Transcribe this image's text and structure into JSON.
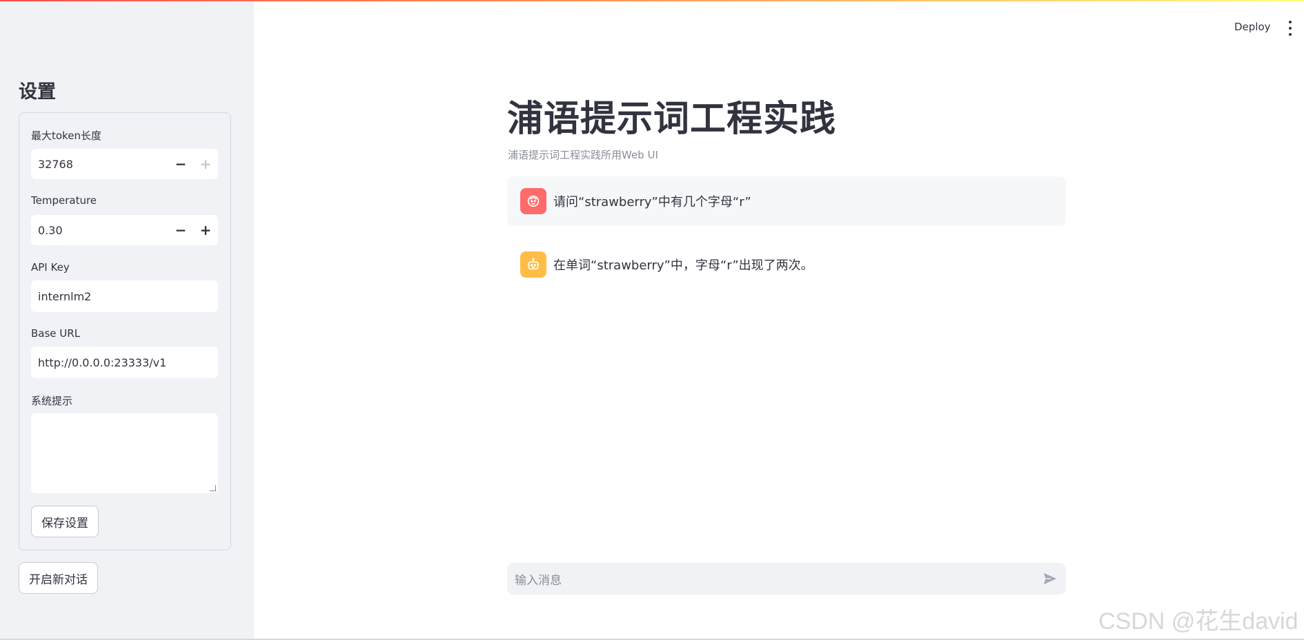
{
  "sidebar": {
    "title": "设置",
    "max_tokens": {
      "label": "最大token长度",
      "value": "32768"
    },
    "temperature": {
      "label": "Temperature",
      "value": "0.30"
    },
    "api_key": {
      "label": "API Key",
      "value": "internlm2"
    },
    "base_url": {
      "label": "Base URL",
      "value": "http://0.0.0.0:23333/v1"
    },
    "system_prompt": {
      "label": "系统提示",
      "value": ""
    },
    "save_label": "保存设置",
    "new_chat_label": "开启新对话"
  },
  "header": {
    "deploy_label": "Deploy"
  },
  "main": {
    "title": "浦语提示词工程实践",
    "caption": "浦语提示词工程实践所用Web UI",
    "messages": [
      {
        "role": "user",
        "avatar_icon": "user-face-icon",
        "text": "请问“strawberry”中有几个字母“r”"
      },
      {
        "role": "assistant",
        "avatar_icon": "robot-icon",
        "text": "在单词“strawberry”中，字母“r”出现了两次。"
      }
    ],
    "chat_input": {
      "placeholder": "输入消息"
    }
  },
  "watermark": "CSDN @花生david",
  "colors": {
    "sidebar_bg": "#f0f2f6",
    "user_avatar": "#ff6b6b",
    "bot_avatar": "#ffbd45",
    "text": "#31333f"
  }
}
